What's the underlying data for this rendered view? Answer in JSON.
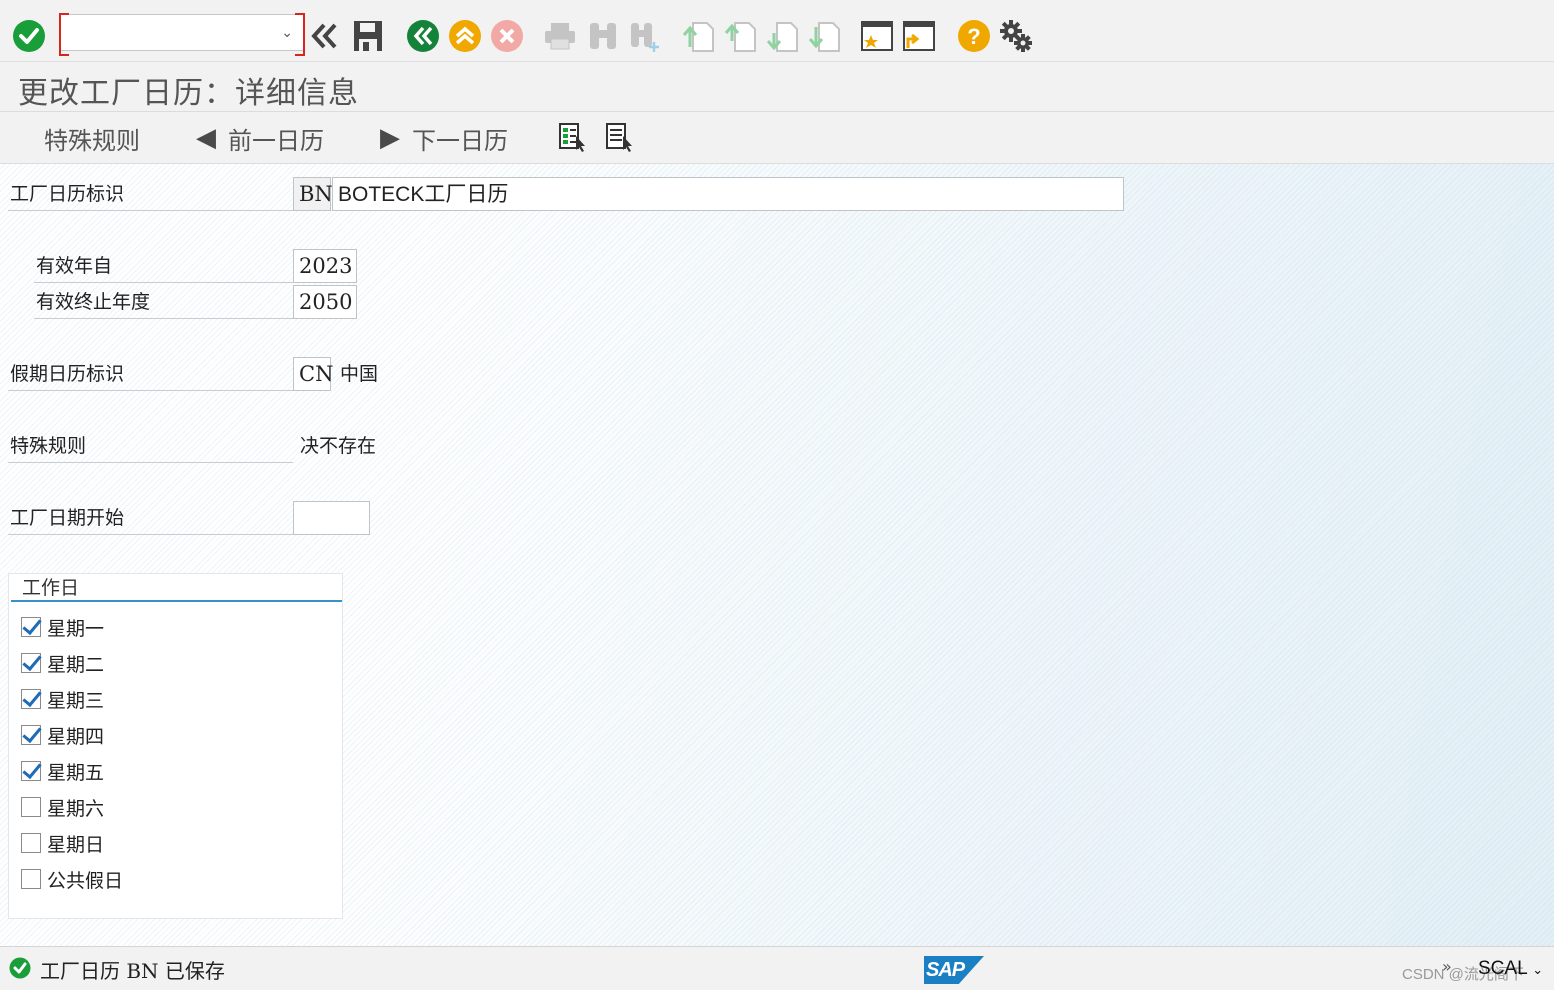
{
  "toolbar": {
    "command_field_value": "",
    "icons": [
      "enter-icon",
      "back-double-icon",
      "save-icon",
      "back-icon",
      "exit-icon",
      "cancel-icon",
      "print-icon",
      "find-icon",
      "find-next-icon",
      "first-page-icon",
      "previous-page-icon",
      "next-page-icon",
      "last-page-icon",
      "new-session-icon",
      "shortcut-icon",
      "help-icon",
      "settings-icon"
    ]
  },
  "title": "更改工厂日历：详细信息",
  "app_toolbar": {
    "special_rules": "特殊规则",
    "prev_calendar": "前一日历",
    "next_calendar": "下一日历"
  },
  "form": {
    "factory_calendar_id_label": "工厂日历标识",
    "factory_calendar_id": "BN",
    "factory_calendar_desc": "BOTECK工厂日历",
    "valid_from_label": "有效年自",
    "valid_from": "2023",
    "valid_to_label": "有效终止年度",
    "valid_to": "2050",
    "holiday_calendar_label": "假期日历标识",
    "holiday_calendar_id": "CN",
    "holiday_calendar_desc": "中国",
    "special_rules_label": "特殊规则",
    "special_rules_value": "决不存在",
    "factory_date_start_label": "工厂日期开始",
    "factory_date_start": ""
  },
  "workdays": {
    "title": "工作日",
    "items": [
      {
        "label": "星期一",
        "checked": true
      },
      {
        "label": "星期二",
        "checked": true
      },
      {
        "label": "星期三",
        "checked": true
      },
      {
        "label": "星期四",
        "checked": true
      },
      {
        "label": "星期五",
        "checked": true
      },
      {
        "label": "星期六",
        "checked": false
      },
      {
        "label": "星期日",
        "checked": false
      },
      {
        "label": "公共假日",
        "checked": false
      }
    ]
  },
  "status": {
    "message": "工厂日历 BN 已保存",
    "system": "SCAL",
    "logo": "SAP",
    "watermark": "CSDN @流光阁下"
  },
  "colors": {
    "green": "#1a9e3a",
    "orange": "#f0a800",
    "red_disabled": "#f2a9a6",
    "sap_blue": "#1b7fc4",
    "accent_line": "#3a8fc7"
  }
}
